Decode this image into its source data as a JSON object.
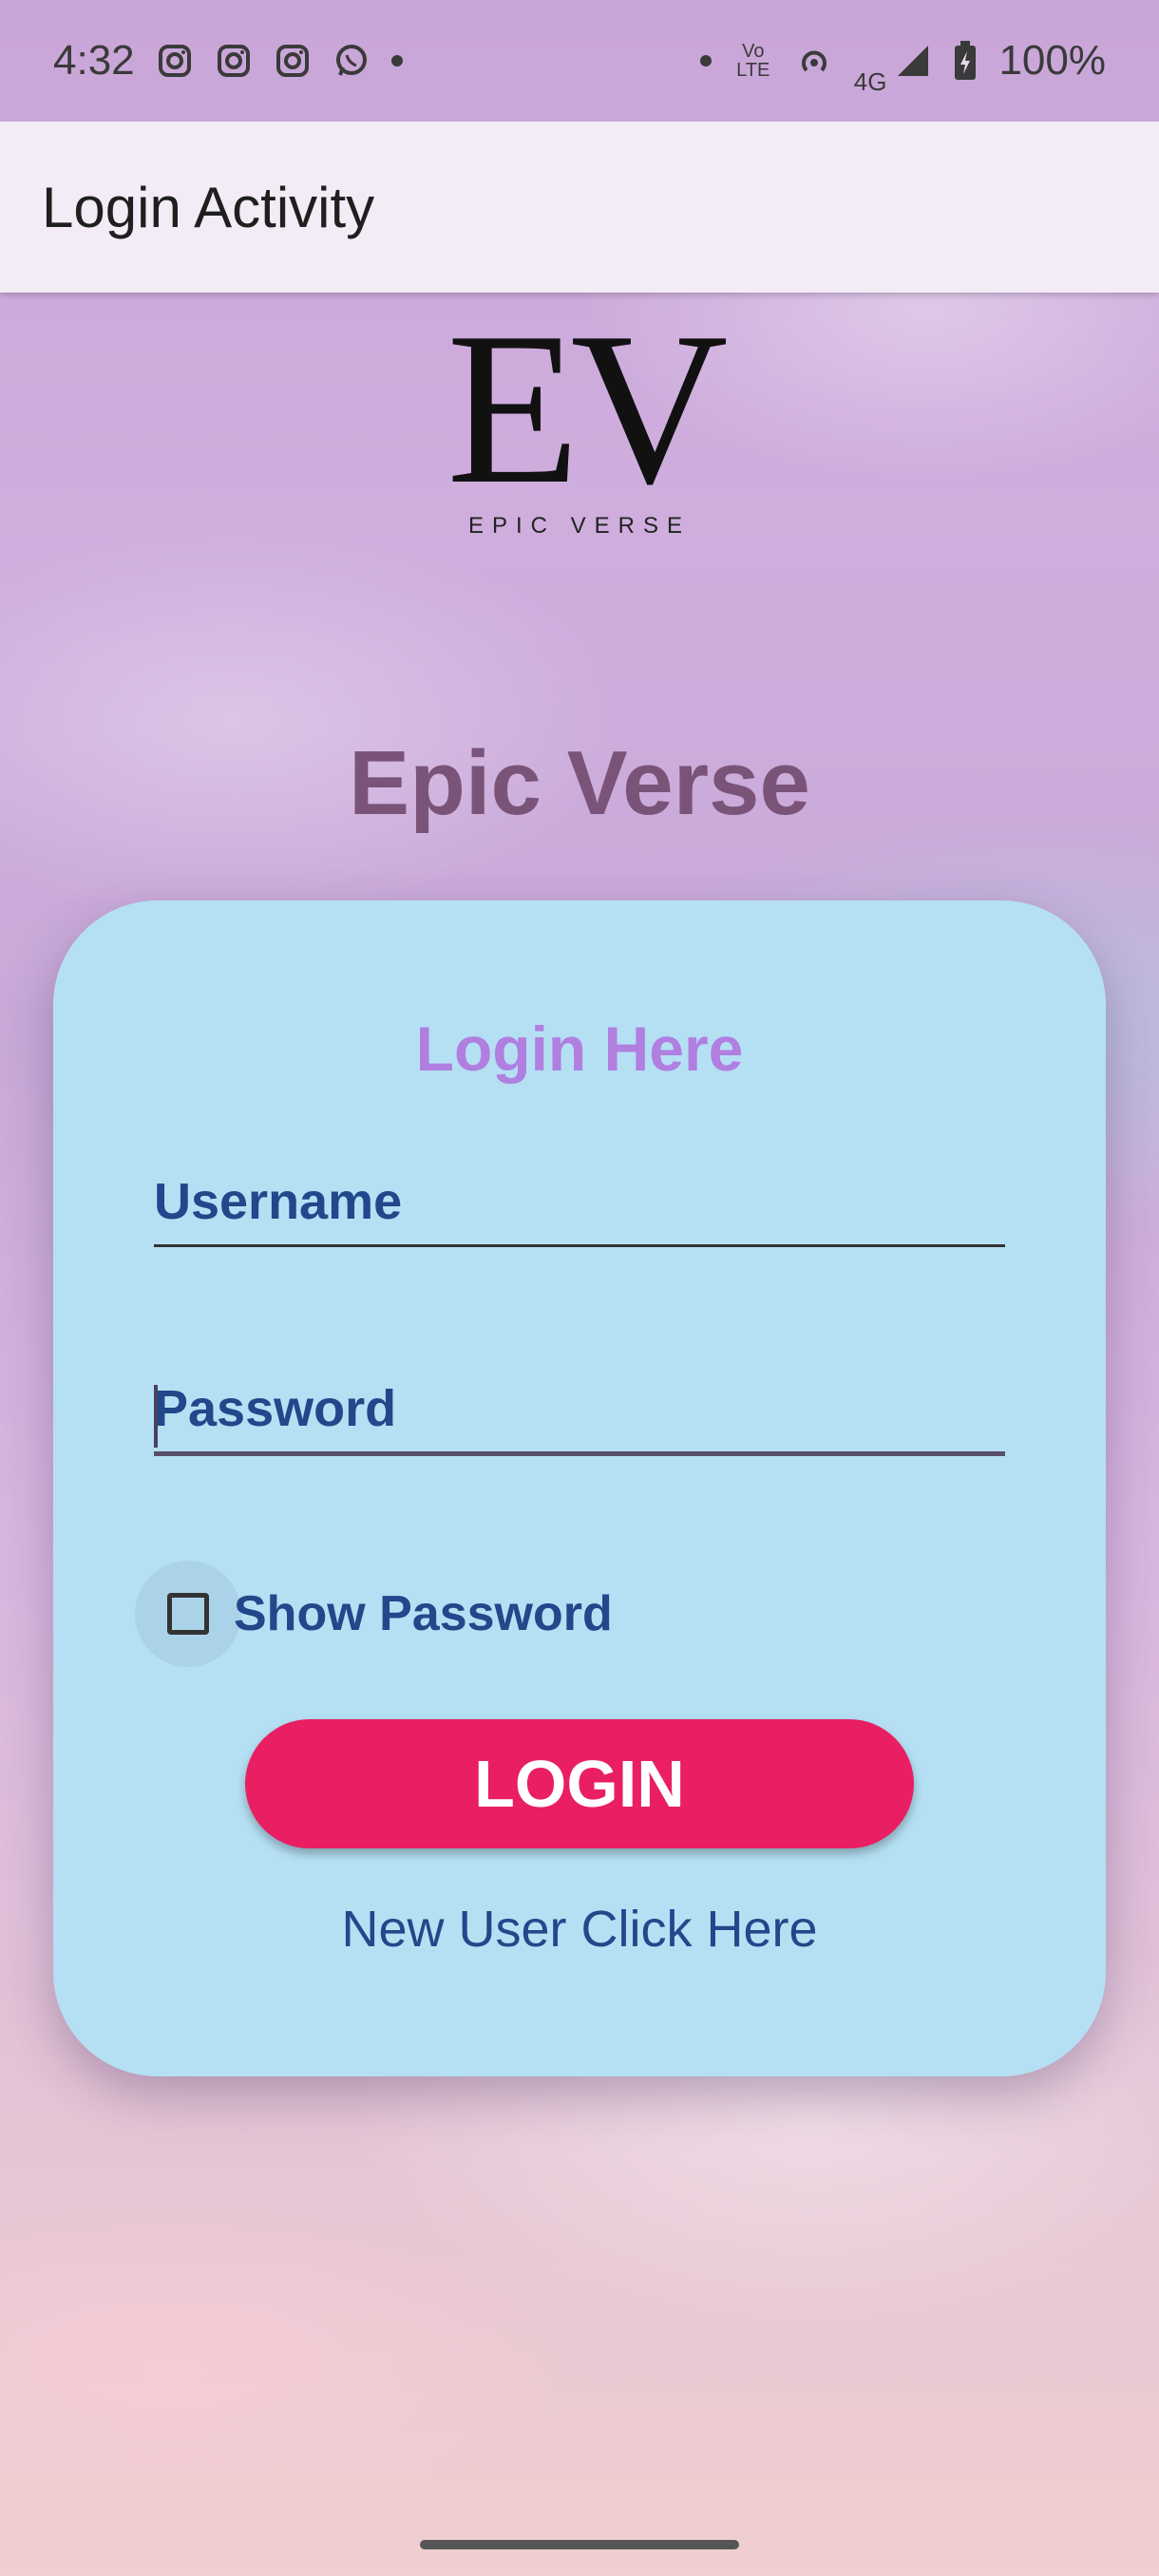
{
  "status_bar": {
    "time": "4:32",
    "notification_icons": [
      "instagram-icon",
      "instagram-icon",
      "instagram-icon",
      "whatsapp-icon"
    ],
    "network_label": "4G",
    "volte_label": "Vo LTE",
    "battery": "100%"
  },
  "app_bar": {
    "title": "Login Activity"
  },
  "logo": {
    "mark": "EV",
    "subtitle": "EPIC VERSE"
  },
  "brand": {
    "title": "Epic Verse"
  },
  "login_card": {
    "title": "Login Here",
    "username_placeholder": "Username",
    "password_placeholder": "Password",
    "show_password_label": "Show Password",
    "show_password_checked": false,
    "login_button": "LOGIN",
    "new_user_link": "New User Click Here"
  },
  "colors": {
    "card_bg": "#b5e0f4",
    "card_title": "#b07fe0",
    "field_text": "#21488a",
    "button": "#e91e63",
    "brand_title": "#7a5478",
    "app_bar_bg": "#f3ecf7"
  }
}
